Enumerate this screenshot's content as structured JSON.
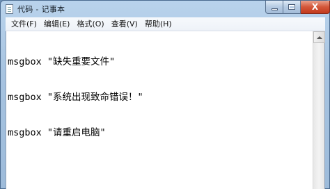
{
  "window": {
    "title": "代码 - 记事本"
  },
  "controls": {
    "close_glyph": "X"
  },
  "menu": {
    "items": [
      {
        "label": "文件(F)"
      },
      {
        "label": "编辑(E)"
      },
      {
        "label": "格式(O)"
      },
      {
        "label": "查看(V)"
      },
      {
        "label": "帮助(H)"
      }
    ]
  },
  "document": {
    "lines": [
      "msgbox \"缺失重要文件\"",
      "msgbox \"系统出现致命错误！\"",
      "msgbox \"请重启电脑\""
    ]
  },
  "colors": {
    "titlebar": "#b9d3ec",
    "close_button": "#c23a1d",
    "editor_background": "#ffffff"
  }
}
